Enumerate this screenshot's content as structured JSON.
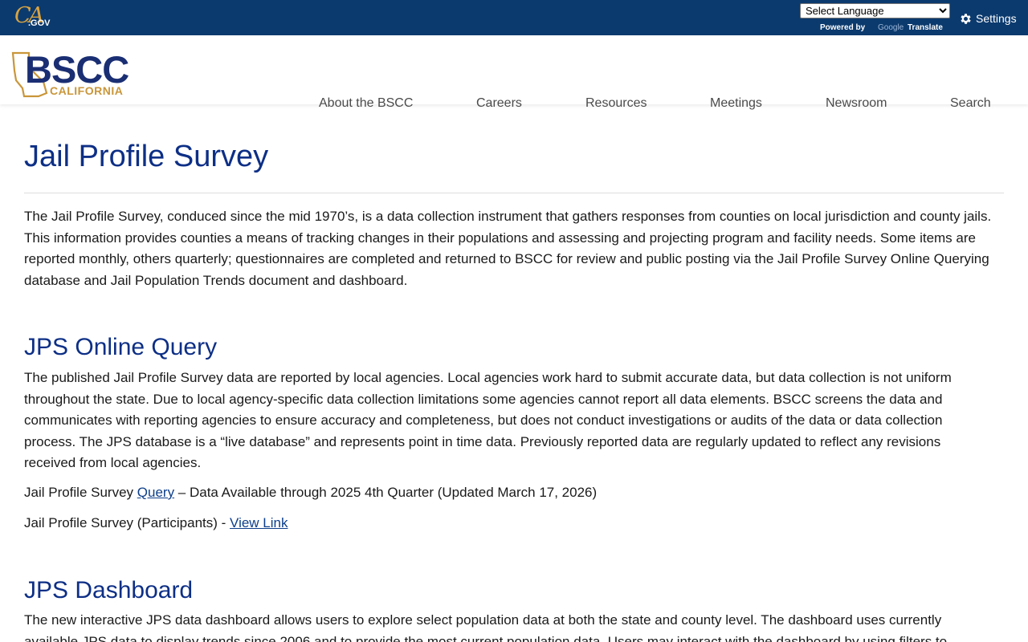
{
  "utility_bar": {
    "cagov_ca": "CA",
    "cagov_gov": ".GOV",
    "language_select": "Select Language",
    "powered_by": "Powered by",
    "google": "Google",
    "translate": "Translate",
    "settings_label": "Settings"
  },
  "header": {
    "logo_main": "BSCC",
    "logo_sub": "CALIFORNIA",
    "nav": [
      "About the BSCC",
      "Careers",
      "Resources",
      "Meetings",
      "Newsroom",
      "Search"
    ]
  },
  "page": {
    "title": "Jail Profile Survey",
    "intro": "The Jail Profile Survey, conduced since the mid 1970’s, is a data collection instrument that gathers responses from counties on local jurisdiction and county jails. This information provides counties a means of tracking changes in their populations and assessing and projecting program and facility needs. Some items are reported monthly, others quarterly; questionnaires are completed and returned to BSCC for review and public posting via the Jail Profile Survey Online Querying database and Jail Population Trends document and dashboard."
  },
  "online_query": {
    "heading": "JPS Online Query",
    "body": "The published Jail Profile Survey data are reported by local agencies. Local agencies work hard to submit accurate data, but data collection is not uniform throughout the state. Due to local agency-specific data collection limitations some agencies cannot report all data elements. BSCC screens the data and communicates with reporting agencies to ensure accuracy and completeness, but does not conduct investigations or audits of the data or data collection process. The JPS database is a “live database” and represents point in time data. Previously reported data are regularly updated to reflect any revisions received from local agencies.",
    "query_prefix": "Jail Profile Survey ",
    "query_link": "Query",
    "query_suffix": " – Data Available through 2025 4th Quarter (Updated March 17, 2026)",
    "participants_prefix": "Jail Profile Survey (Participants) - ",
    "participants_link": "View Link"
  },
  "dashboard": {
    "heading": "JPS Dashboard",
    "body": "The new interactive JPS data dashboard allows users to explore select population data at both the state and county level. The dashboard uses currently available JPS data to display trends since 2006 and to provide the most current population data. Users may interact with the dashboard by using filters to"
  },
  "colors": {
    "top_bar": "#0b3a6e",
    "heading_blue": "#0d2f85",
    "logo_gold": "#c9963a",
    "logo_navy": "#1a2f73"
  }
}
